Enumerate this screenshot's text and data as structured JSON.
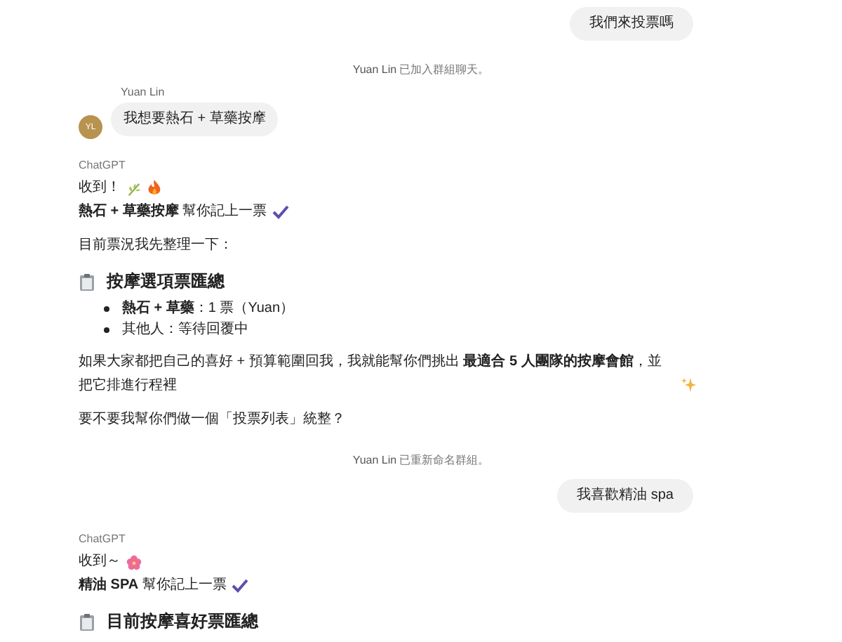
{
  "messages": [
    {
      "kind": "user_bubble",
      "text": "我們來投票嗎"
    },
    {
      "kind": "system",
      "name": "Yuan Lin",
      "text": "已加入群組聊天。"
    },
    {
      "kind": "member_bubble",
      "sender": "Yuan Lin",
      "initials": "YL",
      "text": "我想要熱石 + 草藥按摩"
    },
    {
      "kind": "assistant",
      "sender": "ChatGPT",
      "blocks": [
        {
          "kind": "line",
          "text": "收到！"
        },
        {
          "kind": "line",
          "text": "**熱石 + 草藥按摩** 幫你記上一票"
        },
        {
          "kind": "paragraph",
          "text": "目前票況我先整理一下："
        },
        {
          "kind": "heading",
          "text": "按摩選項票匯總"
        },
        {
          "kind": "bullets",
          "items": [
            "**熱石 + 草藥**：1 票（Yuan）",
            "其他人：等待回覆中"
          ]
        },
        {
          "kind": "paragraph",
          "text": "如果大家都把自己的喜好 + 預算範圍回我，我就能幫你們挑出 **最適合 5 人團隊的按摩會館**，並把它排進行程裡"
        },
        {
          "kind": "paragraph",
          "text": "要不要我幫你們做一個「投票列表」統整？"
        }
      ]
    },
    {
      "kind": "system",
      "name": "Yuan Lin",
      "text": "已重新命名群組。"
    },
    {
      "kind": "user_bubble",
      "text": "我喜歡精油 spa"
    },
    {
      "kind": "assistant",
      "sender": "ChatGPT",
      "blocks": [
        {
          "kind": "line",
          "text": "收到～"
        },
        {
          "kind": "line",
          "text": "**精油 SPA** 幫你記上一票"
        },
        {
          "kind": "heading",
          "text": "目前按摩喜好票匯總"
        }
      ]
    }
  ]
}
